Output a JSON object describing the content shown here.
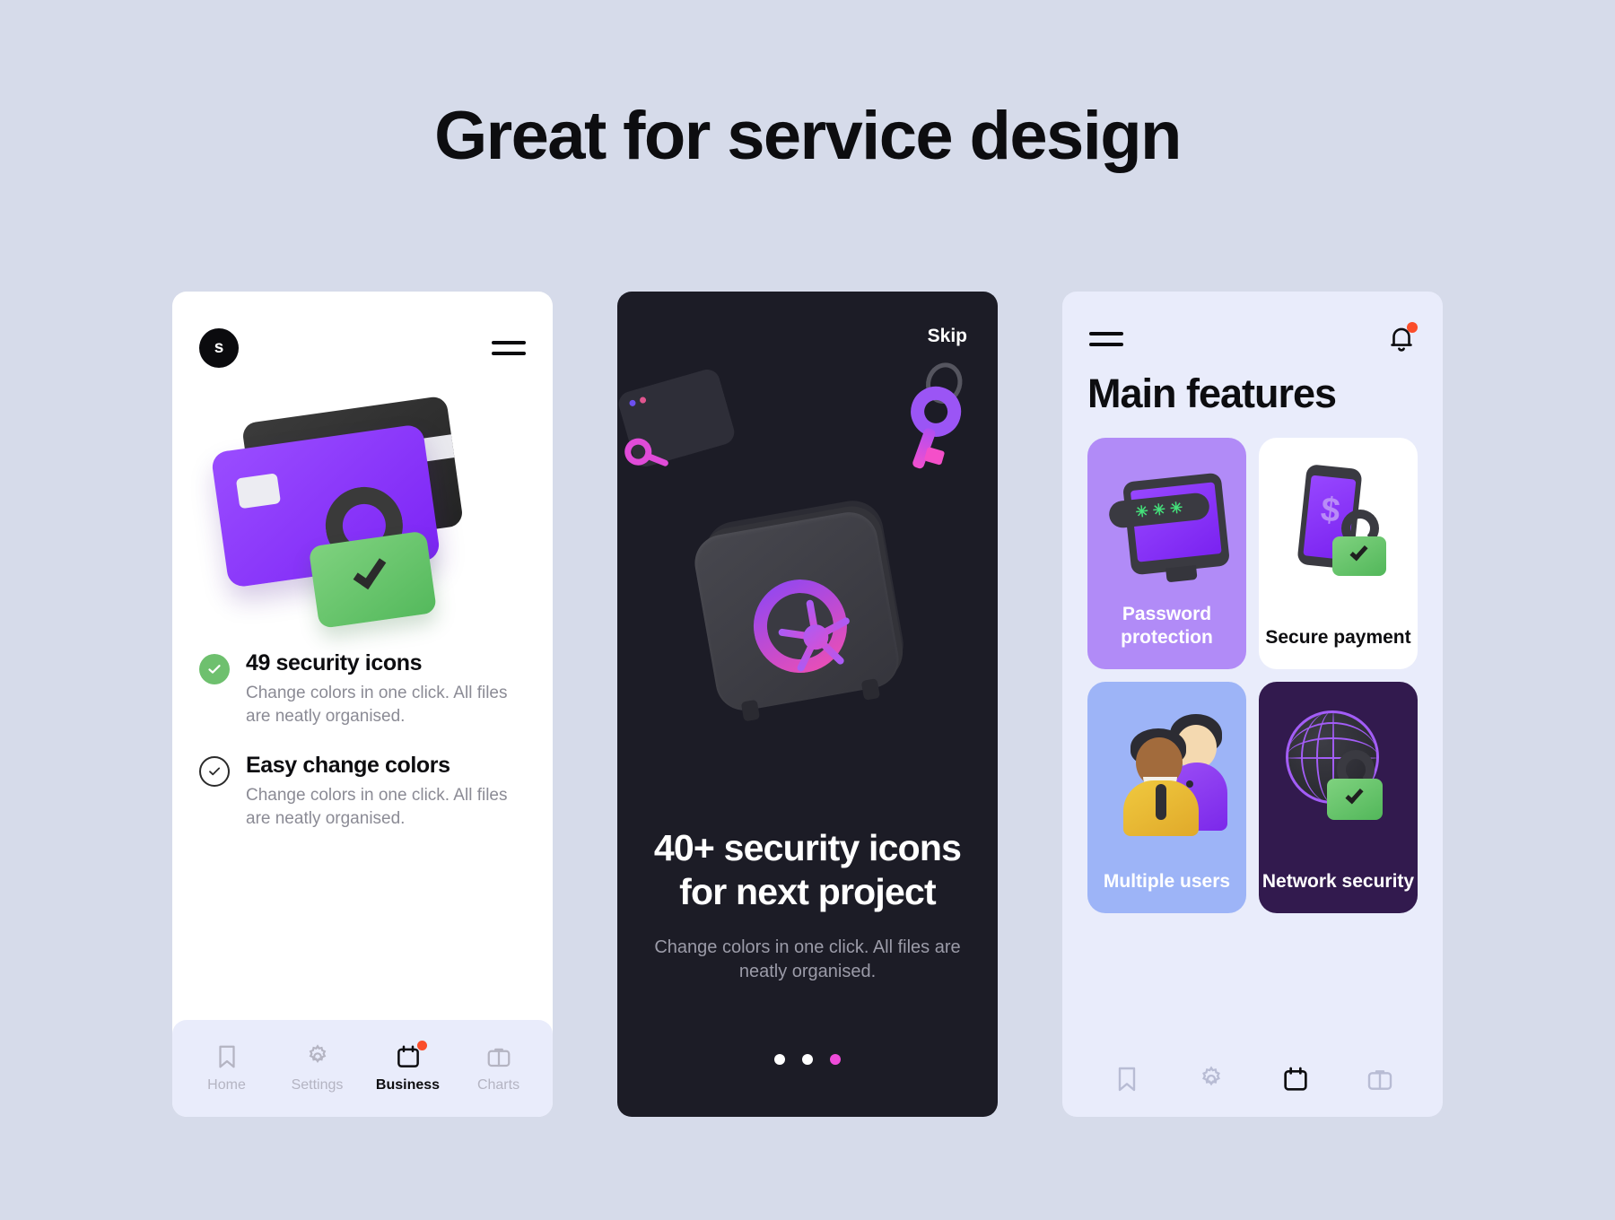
{
  "header": {
    "title": "Great for service design"
  },
  "screen1": {
    "avatar_letter": "s",
    "menu_icon": "hamburger-icon",
    "illustration": "credit-cards-padlock-illustration",
    "features": [
      {
        "title": "49 security icons",
        "desc": "Change colors in one click. All files are neatly organised.",
        "check_style": "filled"
      },
      {
        "title": "Easy change colors",
        "desc": "Change colors in one click. All files are neatly organised.",
        "check_style": "outline"
      }
    ],
    "nav": [
      {
        "label": "Home",
        "icon": "bookmark-icon",
        "active": false,
        "badge": false
      },
      {
        "label": "Settings",
        "icon": "gear-icon",
        "active": false,
        "badge": false
      },
      {
        "label": "Business",
        "icon": "calendar-icon",
        "active": true,
        "badge": true
      },
      {
        "label": "Charts",
        "icon": "briefcase-icon",
        "active": false,
        "badge": false
      }
    ]
  },
  "screen2": {
    "skip_label": "Skip",
    "illustration": "safe-key-window-illustration",
    "headline": "40+ security icons for next project",
    "subtitle": "Change colors in one click. All files are neatly organised.",
    "pagination": {
      "count": 3,
      "active_index": 2
    }
  },
  "screen3": {
    "menu_icon": "hamburger-icon",
    "bell_icon": "bell-icon",
    "has_notification": true,
    "title": "Main features",
    "cards": [
      {
        "label": "Password protection",
        "art": "monitor-password-icon",
        "bg": "#b18bf7",
        "fg": "#ffffff"
      },
      {
        "label": "Secure payment",
        "art": "phone-lock-icon",
        "bg": "#ffffff",
        "fg": "#0d0d10"
      },
      {
        "label": "Multiple users",
        "art": "people-icon",
        "bg": "#9db4f7",
        "fg": "#ffffff"
      },
      {
        "label": "Network security",
        "art": "globe-lock-icon",
        "bg": "#321a4e",
        "fg": "#ffffff"
      }
    ],
    "nav": [
      {
        "icon": "bookmark-icon",
        "active": false
      },
      {
        "icon": "gear-icon",
        "active": false
      },
      {
        "icon": "calendar-icon",
        "active": true
      },
      {
        "icon": "briefcase-icon",
        "active": false
      }
    ]
  },
  "colors": {
    "background": "#d6dbea",
    "dark_screen": "#1c1c26",
    "light_screen": "#e9ecfb",
    "purple": "#8b3dfa",
    "green": "#6bc96b",
    "pink_accent": "#ef4bd9",
    "notification_red": "#fb4d2a"
  }
}
